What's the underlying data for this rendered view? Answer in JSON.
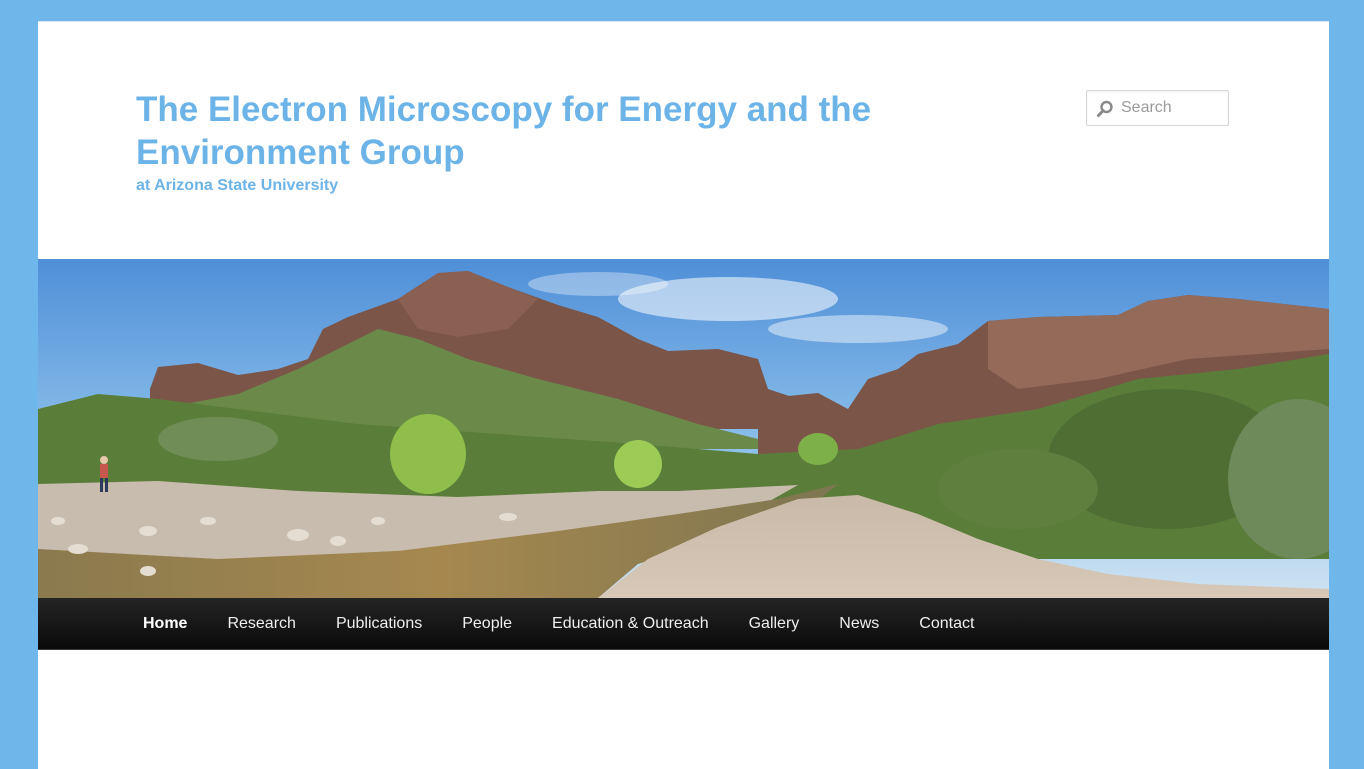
{
  "header": {
    "title": "The Electron Microscopy for Energy and the Environment Group",
    "tagline": "at Arizona State University",
    "accent_color": "#6cb4e8"
  },
  "search": {
    "placeholder": "Search",
    "icon": "search-icon"
  },
  "banner": {
    "alt": "Panoramic view of a desert river canyon"
  },
  "nav": {
    "items": [
      {
        "label": "Home",
        "active": true
      },
      {
        "label": "Research"
      },
      {
        "label": "Publications"
      },
      {
        "label": "People"
      },
      {
        "label": "Education & Outreach"
      },
      {
        "label": "Gallery"
      },
      {
        "label": "News"
      },
      {
        "label": "Contact"
      }
    ]
  },
  "colors": {
    "page_background": "#6fb7ea",
    "nav_background": "#111111",
    "nav_text": "#eeeeee"
  }
}
